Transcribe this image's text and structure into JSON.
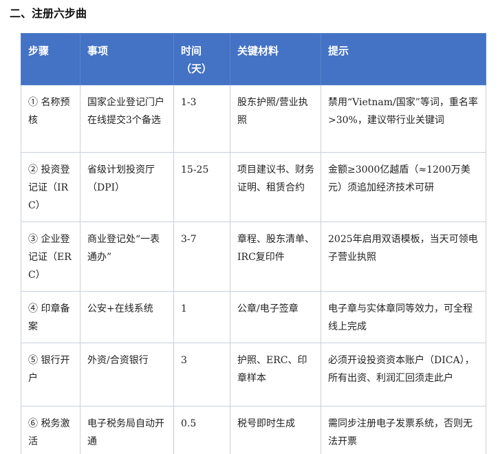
{
  "heading": "二、注册六步曲",
  "table": {
    "headers": {
      "step": "步骤",
      "item": "事项",
      "time": "时间（天）",
      "materials": "关键材料",
      "tips": "提示"
    },
    "rows": [
      {
        "step": "① 名称预核",
        "item": "国家企业登记门户在线提交3个备选",
        "time": "1-3",
        "materials": "股东护照/营业执照",
        "tips": "禁用“Vietnam/国家”等词，重名率>30%，建议带行业关键词"
      },
      {
        "step": "② 投资登记证（IRC）",
        "item": "省级计划投资厅（DPI）",
        "time": "15-25",
        "materials": "项目建议书、财务证明、租赁合约",
        "tips": "金额≥3000亿越盾（≈1200万美元）须追加经济技术可研"
      },
      {
        "step": "③ 企业登记证（ERC）",
        "item": "商业登记处“一表通办”",
        "time": "3-7",
        "materials": "章程、股东清单、IRC复印件",
        "tips": "2025年启用双语模板，当天可领电子营业执照"
      },
      {
        "step": "④ 印章备案",
        "item": "公安+在线系统",
        "time": "1",
        "materials": "公章/电子签章",
        "tips": "电子章与实体章同等效力，可全程线上完成"
      },
      {
        "step": "⑤ 银行开户",
        "item": "外资/合资银行",
        "time": "3",
        "materials": "护照、ERC、印章样本",
        "tips": "必须开设投资资本账户（DICA），所有出资、利润汇回须走此户"
      },
      {
        "step": "⑥ 税务激活",
        "item": "电子税务局自动开通",
        "time": "0.5",
        "materials": "税号即时生成",
        "tips": "需同步注册电子发票系统，否则无法开票"
      }
    ]
  }
}
